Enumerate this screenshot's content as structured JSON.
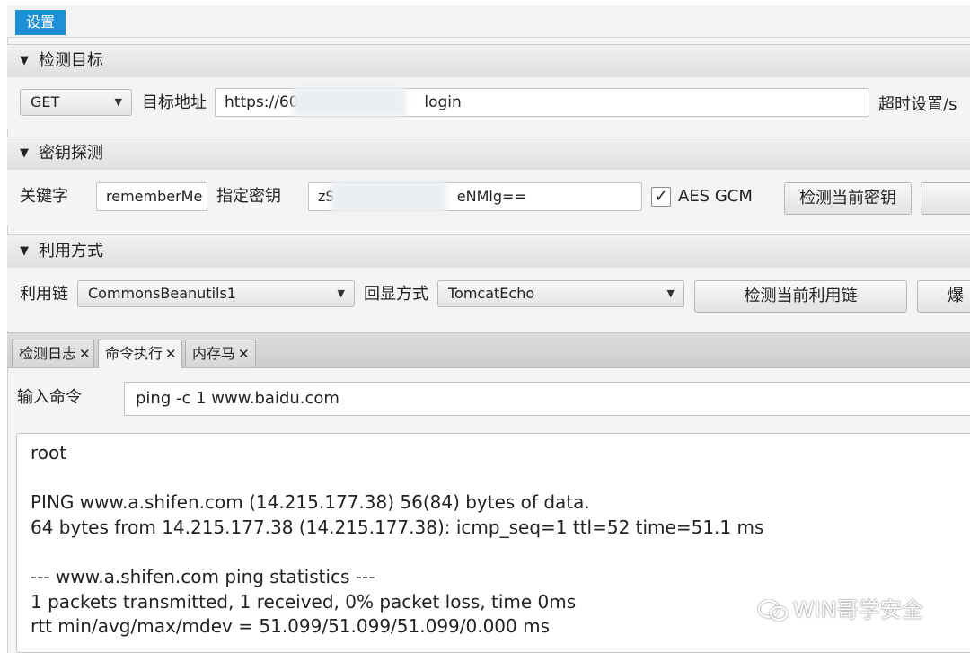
{
  "menubar": {
    "settings": "设置"
  },
  "target_section": {
    "title": "检测目标",
    "method": "GET",
    "url_label": "目标地址",
    "url_prefix": "https://60",
    "url_suffix": "login",
    "timeout_label": "超时设置/s"
  },
  "key_section": {
    "title": "密钥探测",
    "keyword_label": "关键字",
    "keyword_value": "rememberMe",
    "key_label": "指定密钥",
    "key_prefix": "zS",
    "key_suffix": "eNMlg==",
    "aes_gcm_label": "AES GCM",
    "aes_gcm_checked": "✓",
    "detect_key_button": "检测当前密钥"
  },
  "exploit_section": {
    "title": "利用方式",
    "chain_label": "利用链",
    "chain_value": "CommonsBeanutils1",
    "echo_label": "回显方式",
    "echo_value": "TomcatEcho",
    "detect_chain_button": "检测当前利用链",
    "brute_button_partial": "爆"
  },
  "tabs": [
    {
      "label": "检测日志"
    },
    {
      "label": "命令执行"
    },
    {
      "label": "内存马"
    }
  ],
  "tab_close": "✕",
  "command": {
    "label": "输入命令",
    "value": "ping -c 1 www.baidu.com"
  },
  "output_lines": [
    "root",
    "",
    "PING www.a.shifen.com (14.215.177.38) 56(84) bytes of data.",
    "64 bytes from 14.215.177.38 (14.215.177.38): icmp_seq=1 ttl=52 time=51.1 ms",
    "",
    "--- www.a.shifen.com ping statistics ---",
    "1 packets transmitted, 1 received, 0% packet loss, time 0ms",
    "rtt min/avg/max/mdev = 51.099/51.099/51.099/0.000 ms"
  ],
  "watermark": "WIN哥学安全"
}
